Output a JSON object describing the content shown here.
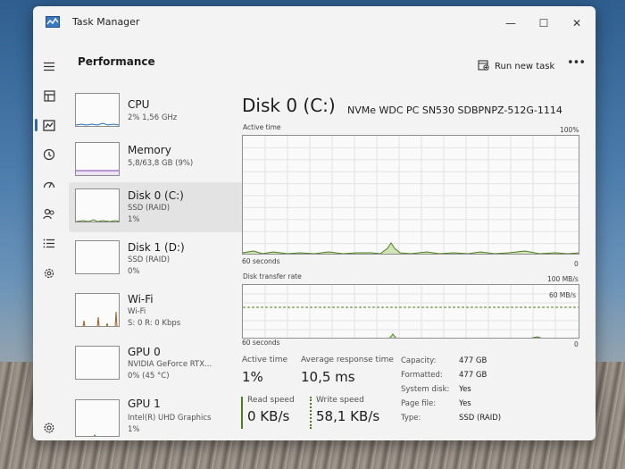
{
  "window": {
    "title": "Task Manager",
    "minimize": "—",
    "maximize": "☐",
    "close": "✕"
  },
  "header": {
    "title": "Performance",
    "run_task": "Run new task",
    "more": "•••"
  },
  "devices": [
    {
      "name": "CPU",
      "sub1": "2% 1,56 GHz",
      "sub2": "",
      "sub3": ""
    },
    {
      "name": "Memory",
      "sub1": "5,8/63,8 GB (9%)",
      "sub2": "",
      "sub3": ""
    },
    {
      "name": "Disk 0 (C:)",
      "sub1": "SSD (RAID)",
      "sub2": "1%",
      "sub3": ""
    },
    {
      "name": "Disk 1 (D:)",
      "sub1": "SSD (RAID)",
      "sub2": "0%",
      "sub3": ""
    },
    {
      "name": "Wi-Fi",
      "sub1": "Wi-Fi",
      "sub2": "S: 0 R: 0 Kbps",
      "sub3": ""
    },
    {
      "name": "GPU 0",
      "sub1": "NVIDIA GeForce RTX...",
      "sub2": "0% (45 °C)",
      "sub3": ""
    },
    {
      "name": "GPU 1",
      "sub1": "Intel(R) UHD Graphics",
      "sub2": "1%",
      "sub3": ""
    }
  ],
  "detail": {
    "title": "Disk 0 (C:)",
    "model": "NVMe WDC PC SN530 SDBPNPZ-512G-1114",
    "active_graph": {
      "label": "Active time",
      "max": "100%",
      "time": "60 seconds",
      "min": "0"
    },
    "transfer_graph": {
      "label": "Disk transfer rate",
      "max": "100 MB/s",
      "mid": "60 MB/s",
      "time": "60 seconds",
      "min": "0"
    },
    "stats": {
      "active_time_label": "Active time",
      "active_time": "1%",
      "avg_resp_label": "Average response time",
      "avg_resp": "10,5 ms",
      "read_label": "Read speed",
      "read": "0 KB/s",
      "write_label": "Write speed",
      "write": "58,1 KB/s"
    },
    "props": [
      {
        "label": "Capacity:",
        "value": "477 GB"
      },
      {
        "label": "Formatted:",
        "value": "477 GB"
      },
      {
        "label": "System disk:",
        "value": "Yes"
      },
      {
        "label": "Page file:",
        "value": "Yes"
      },
      {
        "label": "Type:",
        "value": "SSD (RAID)"
      }
    ]
  },
  "colors": {
    "disk_line": "#4d7d1f",
    "disk_fill": "#d3e3b8",
    "cpu_line": "#1f6fb8",
    "memory_line": "#7b3fb0",
    "wifi_line": "#a55c1b",
    "gpu_line": "#1f6fb8",
    "accent": "#1f6fb8",
    "read_bar": "#4d7d1f"
  },
  "icons": [
    "app-icon",
    "hamburger-icon",
    "processes-icon",
    "performance-icon",
    "app-history-icon",
    "startup-apps-icon",
    "users-icon",
    "details-icon",
    "services-icon",
    "settings-icon",
    "run-task-icon",
    "more-icon"
  ]
}
